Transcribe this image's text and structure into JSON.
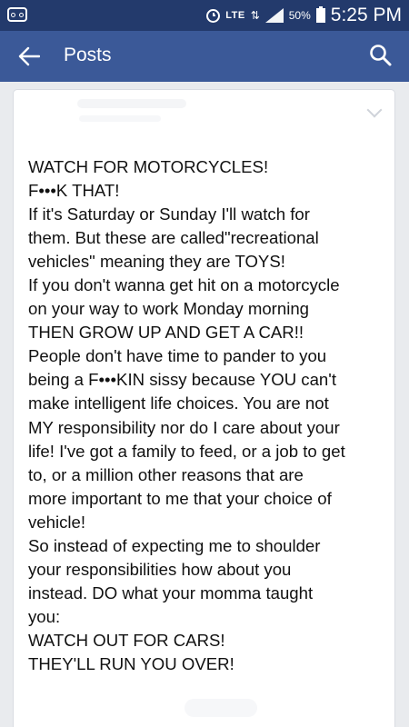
{
  "status_bar": {
    "lte": "LTE",
    "battery": "50%",
    "time": "5:25 PM",
    "icons": [
      "voicemail-icon",
      "alarm-icon",
      "data-arrows-icon",
      "signal-icon",
      "battery-icon"
    ]
  },
  "app_bar": {
    "title": "Posts",
    "back_icon": "back-arrow-icon",
    "search_icon": "search-icon",
    "color": "#3b5998",
    "status_color": "#233a6c"
  },
  "post": {
    "lines": [
      "WATCH FOR MOTORCYCLES!",
      "F•••K THAT!",
      "If it's Saturday or Sunday I'll watch for",
      "them. But these are called\"recreational",
      "vehicles\" meaning they are TOYS!",
      "If you don't wanna get hit on a motorcycle",
      "on your way to work Monday morning",
      "THEN GROW UP AND GET A CAR!!",
      "People don't have time to pander to you",
      "being a F•••KIN sissy because YOU can't",
      "make intelligent life choices. You are not",
      "MY responsibility nor do I care about your",
      "life! I've got a family to feed, or a job to get",
      "to, or a million other reasons that are",
      "more important to me that your choice of",
      "vehicle!",
      "So instead of expecting me to shoulder",
      "your responsibilities how about you",
      "instead. DO what your momma taught",
      "you:",
      "WATCH OUT FOR CARS!",
      "THEY'LL RUN YOU OVER!"
    ]
  }
}
